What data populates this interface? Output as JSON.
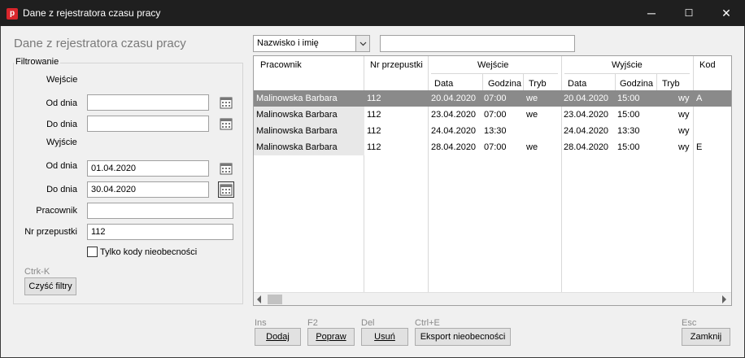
{
  "window": {
    "title": "Dane z rejestratora czasu pracy",
    "minimize": "─",
    "maximize": "☐",
    "close": "✕",
    "app_icon_letter": "p"
  },
  "page_title": "Dane z rejestratora czasu pracy",
  "filter": {
    "legend": "Filtrowanie",
    "entry_section": "Wejście",
    "exit_section": "Wyjście",
    "from_label": "Od dnia",
    "to_label": "Do dnia",
    "entry_from": "",
    "entry_to": "",
    "exit_from": "01.04.2020",
    "exit_to": "30.04.2020",
    "employee_label": "Pracownik",
    "employee_value": "",
    "badge_label": "Nr przepustki",
    "badge_value": "112",
    "absence_only_label": "Tylko kody nieobecności",
    "absence_only_checked": false,
    "clear_hint": "Ctrk-K",
    "clear_button": "Czyść filtry"
  },
  "toolbar": {
    "sort_combo": "Nazwisko i imię",
    "search_value": ""
  },
  "grid": {
    "headers": {
      "employee": "Pracownik",
      "badge": "Nr przepustki",
      "entry": "Wejście",
      "exit": "Wyjście",
      "code": "Kod",
      "date": "Data",
      "time": "Godzina",
      "mode": "Tryb"
    },
    "rows": [
      {
        "employee": "Malinowska Barbara",
        "badge": "112",
        "in_date": "20.04.2020",
        "in_time": "07:00",
        "in_mode": "we",
        "out_date": "20.04.2020",
        "out_time": "15:00",
        "out_mode": "wy",
        "code": "A"
      },
      {
        "employee": "Malinowska Barbara",
        "badge": "112",
        "in_date": "23.04.2020",
        "in_time": "07:00",
        "in_mode": "we",
        "out_date": "23.04.2020",
        "out_time": "15:00",
        "out_mode": "wy",
        "code": ""
      },
      {
        "employee": "Malinowska Barbara",
        "badge": "112",
        "in_date": "24.04.2020",
        "in_time": "13:30",
        "in_mode": "",
        "out_date": "24.04.2020",
        "out_time": "13:30",
        "out_mode": "wy",
        "code": ""
      },
      {
        "employee": "Malinowska Barbara",
        "badge": "112",
        "in_date": "28.04.2020",
        "in_time": "07:00",
        "in_mode": "we",
        "out_date": "28.04.2020",
        "out_time": "15:00",
        "out_mode": "wy",
        "code": "E"
      }
    ],
    "selected_row": 0
  },
  "actions": {
    "add_hint": "Ins",
    "add": "Dodaj",
    "edit_hint": "F2",
    "edit": "Popraw",
    "delete_hint": "Del",
    "delete": "Usuń",
    "export_hint": "Ctrl+E",
    "export": "Eksport nieobecności",
    "close_hint": "Esc",
    "close": "Zamknij"
  }
}
